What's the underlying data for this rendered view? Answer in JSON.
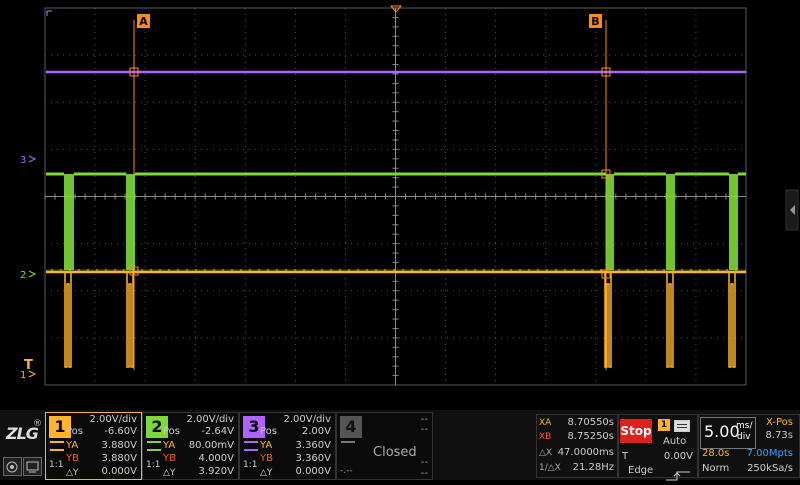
{
  "colors": {
    "ch1": "#ffb42a",
    "ch2": "#7ed83a",
    "ch3": "#b064ff",
    "cursor": "#ff8a1a",
    "grid": "#5a5a5a",
    "stop": "#e0201a"
  },
  "brand": {
    "logo_text": "ZLG",
    "registered": "®"
  },
  "cursors": {
    "a_label": "A",
    "b_label": "B"
  },
  "markers": {
    "ch3": "3",
    "ch2": "2",
    "ch1": "1",
    "trigger": "T"
  },
  "channels": [
    {
      "num": "1",
      "vdiv": "2.00V/div",
      "pos_label": "Pos",
      "pos": "-6.60V",
      "ya_label": "YA",
      "ya": "3.880V",
      "yb_label": "YB",
      "yb": "3.880V",
      "dy_label": "△Y",
      "dy": "0.000V",
      "coupling": "1:1"
    },
    {
      "num": "2",
      "vdiv": "2.00V/div",
      "pos_label": "Pos",
      "pos": "-2.64V",
      "ya_label": "YA",
      "ya": "80.00mV",
      "yb_label": "YB",
      "yb": "4.000V",
      "dy_label": "△Y",
      "dy": "3.920V",
      "coupling": "1:1"
    },
    {
      "num": "3",
      "vdiv": "2.00V/div",
      "pos_label": "Pos",
      "pos": "2.00V",
      "ya_label": "YA",
      "ya": "3.360V",
      "yb_label": "YB",
      "yb": "3.360V",
      "dy_label": "△Y",
      "dy": "0.000V",
      "coupling": "1:1"
    },
    {
      "num": "4",
      "top1": "--",
      "top2": "--",
      "status": "Closed",
      "bot1": "--",
      "bot2": "--",
      "dash": "-.--"
    }
  ],
  "measure": {
    "xa_label": "XA",
    "xa": "8.70550s",
    "xb_label": "XB",
    "xb": "8.75250s",
    "dx_label": "△X",
    "dx": "47.0000ms",
    "freq_label": "1/△X",
    "freq": "21.28Hz"
  },
  "run": {
    "state": "Stop",
    "trigger_src": "1",
    "mode": "Auto",
    "t_label": "T",
    "level": "0.00V",
    "type": "Edge"
  },
  "timebase": {
    "value": "5.00",
    "unit_top": "ms/",
    "unit_bot": "div",
    "window": "28.0s",
    "points": "7.00Mpts",
    "acq_mode": "Norm",
    "xpos_label": "X-Pos",
    "xpos": "8.73s",
    "rate": "250kSa/s"
  }
}
